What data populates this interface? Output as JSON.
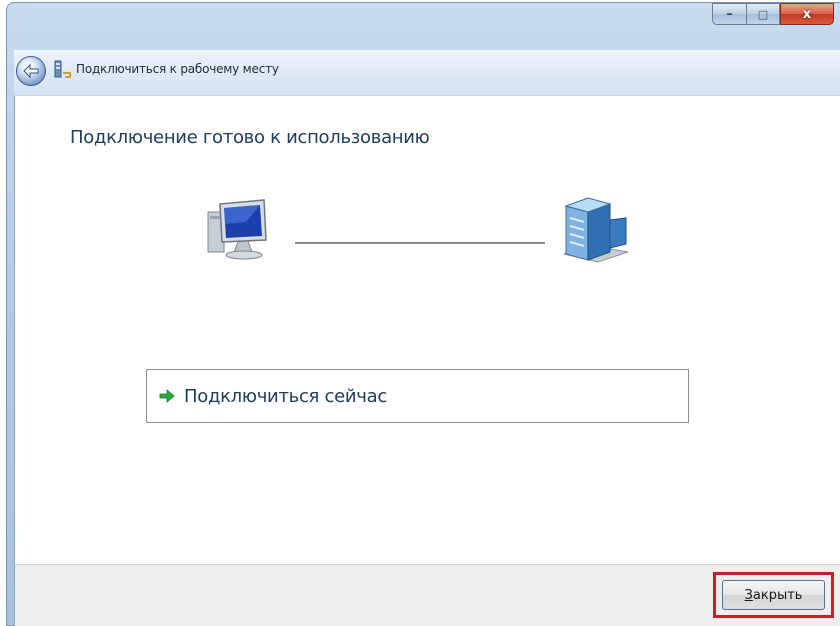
{
  "window": {
    "title": "Подключиться к рабочему месту",
    "caption": {
      "minimize": "–",
      "maximize": "□",
      "close": "x"
    }
  },
  "main": {
    "heading": "Подключение готово к использованию",
    "connect_option": {
      "label": "Подключиться сейчас",
      "icon": "green-arrow-right-icon"
    },
    "diagram": {
      "left_icon": "computer-icon",
      "right_icon": "server-icon"
    }
  },
  "footer": {
    "close_button": {
      "accel": "З",
      "rest": "акрыть"
    }
  },
  "colors": {
    "heading_text": "#1f3c62",
    "highlight_border": "#cc1f24",
    "arrow": "#2aa53a"
  }
}
